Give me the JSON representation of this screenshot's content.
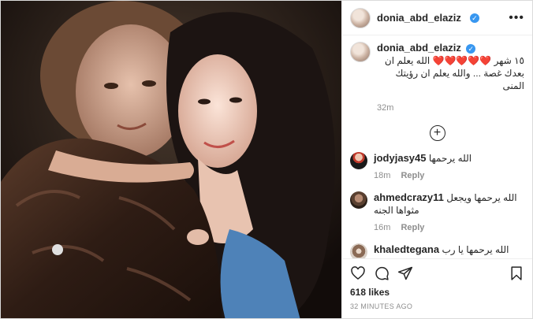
{
  "post": {
    "username": "donia_abd_elaziz",
    "verified_mark": "✓",
    "more_label": "•••"
  },
  "caption": {
    "username": "donia_abd_elaziz",
    "text": "١٥ شهر ❤️❤️❤️❤️❤️ الله يعلم ان بعدك غصة ... والله يعلم ان رؤيتك المنى",
    "time": "32m"
  },
  "load_more": "+",
  "comments": [
    {
      "username": "jodyjasy45",
      "text": "الله يرحمها",
      "time": "18m",
      "reply": "Reply"
    },
    {
      "username": "ahmedcrazy11",
      "text": "الله يرحمها ويجعل مثواها الجنه",
      "time": "16m",
      "reply": "Reply"
    },
    {
      "username": "khaledtegana",
      "text": "الله يرحمها يا رب حبيبت الكل والله",
      "time": "",
      "reply": ""
    }
  ],
  "actions": {
    "icons": [
      "heart-icon",
      "comment-icon",
      "share-icon",
      "bookmark-icon"
    ]
  },
  "likes": "618 likes",
  "posted_ago": "32 MINUTES AGO"
}
